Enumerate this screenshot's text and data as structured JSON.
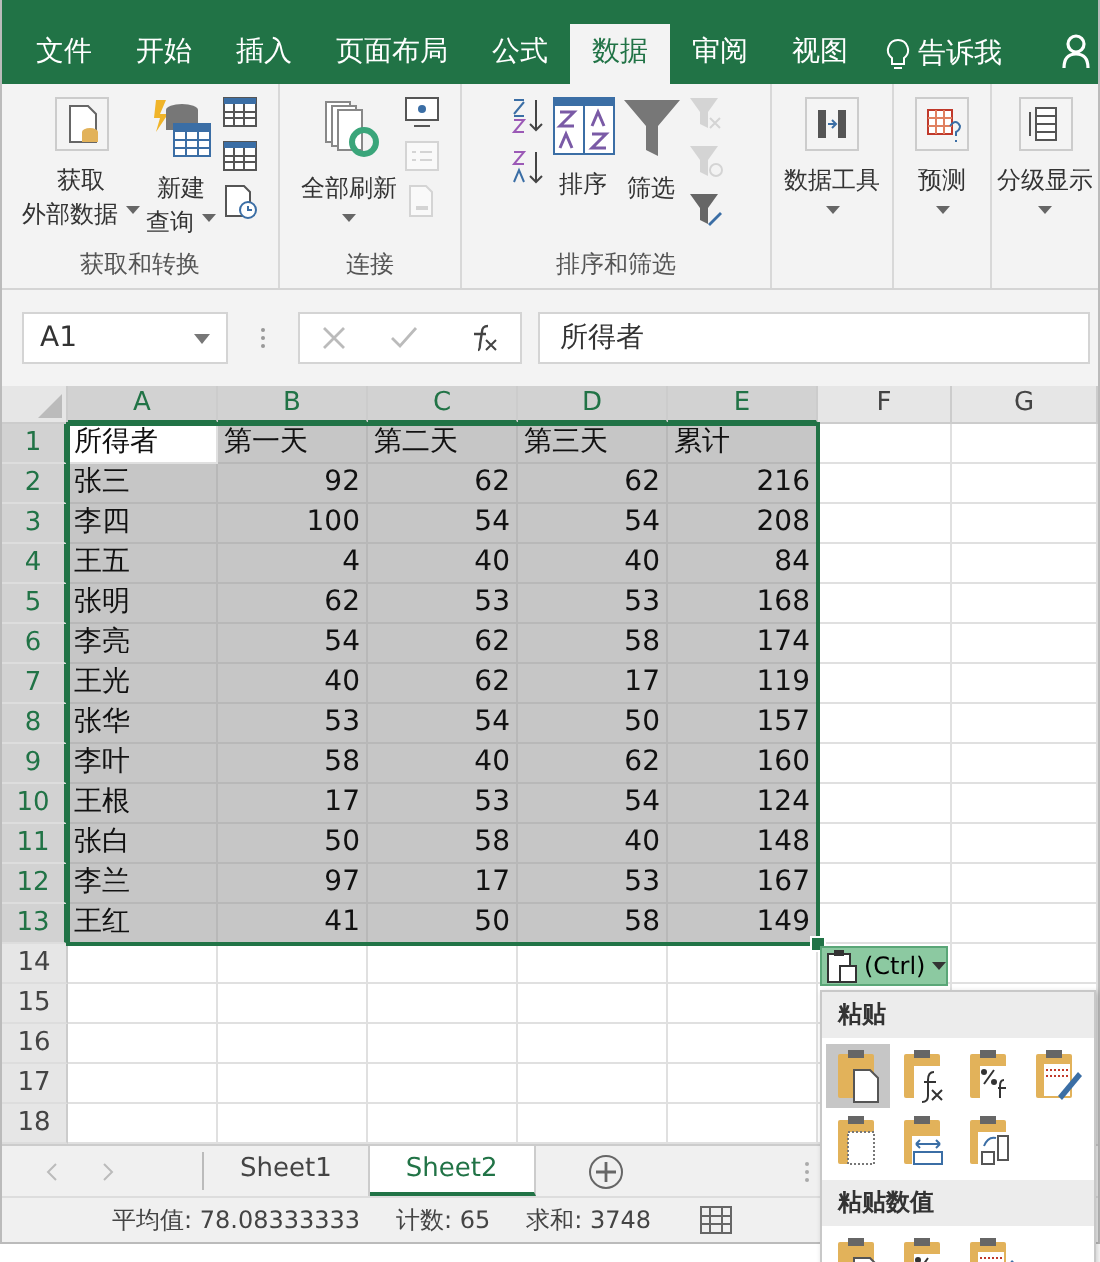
{
  "tabs": [
    {
      "label": "文件",
      "selected": false
    },
    {
      "label": "开始",
      "selected": false
    },
    {
      "label": "插入",
      "selected": false
    },
    {
      "label": "页面布局",
      "selected": false
    },
    {
      "label": "公式",
      "selected": false
    },
    {
      "label": "数据",
      "selected": true
    },
    {
      "label": "审阅",
      "selected": false
    },
    {
      "label": "视图",
      "selected": false
    }
  ],
  "tell_me": "告诉我",
  "ribbon_groups": [
    {
      "label": "获取和转换",
      "controls": [
        {
          "kind": "large",
          "lines": [
            "获取",
            "外部数据"
          ],
          "dropdown": true
        },
        {
          "kind": "large",
          "lines": [
            "新建",
            "查询"
          ],
          "dropdown": true
        },
        {
          "kind": "stack",
          "icons": [
            {
              "disabled": false
            },
            {
              "disabled": false
            },
            {
              "disabled": false
            }
          ]
        }
      ]
    },
    {
      "label": "连接",
      "controls": [
        {
          "kind": "large",
          "lines": [
            "全部刷新"
          ],
          "dropdown": true
        },
        {
          "kind": "stack",
          "icons": [
            {
              "disabled": false
            },
            {
              "disabled": true
            },
            {
              "disabled": true
            }
          ]
        }
      ]
    },
    {
      "label": "排序和筛选",
      "controls": [
        {
          "kind": "stack",
          "icons": [
            {
              "disabled": false
            },
            {
              "disabled": false
            }
          ]
        },
        {
          "kind": "large",
          "lines": [
            "排序"
          ],
          "dropdown": false
        },
        {
          "kind": "large",
          "lines": [
            "筛选"
          ],
          "dropdown": false
        },
        {
          "kind": "stack",
          "icons": [
            {
              "disabled": true
            },
            {
              "disabled": true
            },
            {
              "disabled": false
            }
          ]
        }
      ]
    },
    {
      "controls": [
        {
          "kind": "large",
          "lines": [
            "数据工具"
          ],
          "dropdown": true
        }
      ]
    },
    {
      "controls": [
        {
          "kind": "large",
          "lines": [
            "预测"
          ],
          "dropdown": true
        }
      ]
    },
    {
      "controls": [
        {
          "kind": "large",
          "lines": [
            "分级显示"
          ],
          "dropdown": true
        }
      ]
    }
  ],
  "name_box": "A1",
  "formula": "所得者",
  "columns": [
    {
      "label": "A",
      "selected": true
    },
    {
      "label": "B",
      "selected": true
    },
    {
      "label": "C",
      "selected": true
    },
    {
      "label": "D",
      "selected": true
    },
    {
      "label": "E",
      "selected": true
    },
    {
      "label": "F",
      "selected": false
    },
    {
      "label": "G",
      "selected": false
    }
  ],
  "rows": [
    {
      "number": "1",
      "selected": true,
      "kind": "header",
      "cells": [
        "所得者",
        "第一天",
        "第二天",
        "第三天",
        "累计"
      ]
    },
    {
      "number": "2",
      "selected": true,
      "kind": "data",
      "cells": [
        "张三",
        "92",
        "62",
        "62",
        "216"
      ]
    },
    {
      "number": "3",
      "selected": true,
      "kind": "data",
      "cells": [
        "李四",
        "100",
        "54",
        "54",
        "208"
      ]
    },
    {
      "number": "4",
      "selected": true,
      "kind": "data",
      "cells": [
        "王五",
        "4",
        "40",
        "40",
        "84"
      ]
    },
    {
      "number": "5",
      "selected": true,
      "kind": "data",
      "cells": [
        "张明",
        "62",
        "53",
        "53",
        "168"
      ]
    },
    {
      "number": "6",
      "selected": true,
      "kind": "data",
      "cells": [
        "李亮",
        "54",
        "62",
        "58",
        "174"
      ]
    },
    {
      "number": "7",
      "selected": true,
      "kind": "data",
      "cells": [
        "王光",
        "40",
        "62",
        "17",
        "119"
      ]
    },
    {
      "number": "8",
      "selected": true,
      "kind": "data",
      "cells": [
        "张华",
        "53",
        "54",
        "50",
        "157"
      ]
    },
    {
      "number": "9",
      "selected": true,
      "kind": "data",
      "cells": [
        "李叶",
        "58",
        "40",
        "62",
        "160"
      ]
    },
    {
      "number": "10",
      "selected": true,
      "kind": "data",
      "cells": [
        "王根",
        "17",
        "53",
        "54",
        "124"
      ]
    },
    {
      "number": "11",
      "selected": true,
      "kind": "data",
      "cells": [
        "张白",
        "50",
        "58",
        "40",
        "148"
      ]
    },
    {
      "number": "12",
      "selected": true,
      "kind": "data",
      "cells": [
        "李兰",
        "97",
        "17",
        "53",
        "167"
      ]
    },
    {
      "number": "13",
      "selected": true,
      "kind": "data",
      "cells": [
        "王红",
        "41",
        "50",
        "58",
        "149"
      ]
    },
    {
      "number": "14",
      "selected": false,
      "kind": "data",
      "cells": []
    },
    {
      "number": "15",
      "selected": false,
      "kind": "data",
      "cells": []
    },
    {
      "number": "16",
      "selected": false,
      "kind": "data",
      "cells": []
    },
    {
      "number": "17",
      "selected": false,
      "kind": "data",
      "cells": []
    },
    {
      "number": "18",
      "selected": false,
      "kind": "data",
      "cells": []
    }
  ],
  "sheet_tabs": [
    {
      "label": "Sheet1",
      "selected": false
    },
    {
      "label": "Sheet2",
      "selected": true
    }
  ],
  "status_bar": [
    "平均值: 78.08333333",
    "计数: 65",
    "求和: 3748"
  ],
  "paste_options": {
    "button": "(Ctrl)",
    "sections": [
      {
        "title": "粘贴",
        "items": [
          {
            "selected": true
          },
          {
            "selected": false
          },
          {
            "selected": false
          },
          {
            "selected": false
          },
          {
            "selected": false
          },
          {
            "selected": false
          },
          {
            "selected": false
          }
        ]
      },
      {
        "title": "粘贴数值",
        "items": [
          {
            "selected": false
          },
          {
            "selected": false
          },
          {
            "selected": false
          }
        ]
      }
    ]
  }
}
